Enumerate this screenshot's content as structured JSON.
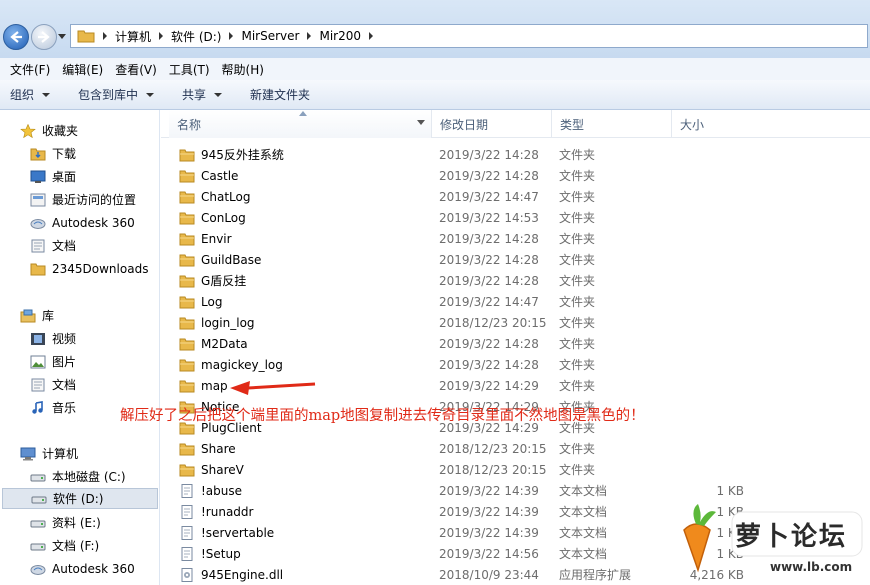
{
  "address": {
    "crumbs": [
      "计算机",
      "软件 (D:)",
      "MirServer",
      "Mir200"
    ]
  },
  "menu": [
    "文件(F)",
    "编辑(E)",
    "查看(V)",
    "工具(T)",
    "帮助(H)"
  ],
  "toolbar": {
    "organize": "组织",
    "include_library": "包含到库中",
    "share": "共享",
    "new_folder": "新建文件夹"
  },
  "sidebar": {
    "favorites": "收藏夹",
    "fav_items": [
      "下载",
      "桌面",
      "最近访问的位置",
      "Autodesk 360",
      "文档",
      "2345Downloads"
    ],
    "libraries": "库",
    "lib_items": [
      "视频",
      "图片",
      "文档",
      "音乐"
    ],
    "computer": "计算机",
    "comp_items": [
      "本地磁盘 (C:)",
      "软件 (D:)",
      "资料 (E:)",
      "文档 (F:)",
      "Autodesk 360"
    ]
  },
  "columns": {
    "name": "名称",
    "date": "修改日期",
    "type": "类型",
    "size": "大小"
  },
  "files": [
    {
      "name": "945反外挂系统",
      "date": "2019/3/22 14:28",
      "type": "文件夹",
      "size": "",
      "kind": "folder"
    },
    {
      "name": "Castle",
      "date": "2019/3/22 14:28",
      "type": "文件夹",
      "size": "",
      "kind": "folder"
    },
    {
      "name": "ChatLog",
      "date": "2019/3/22 14:47",
      "type": "文件夹",
      "size": "",
      "kind": "folder"
    },
    {
      "name": "ConLog",
      "date": "2019/3/22 14:53",
      "type": "文件夹",
      "size": "",
      "kind": "folder"
    },
    {
      "name": "Envir",
      "date": "2019/3/22 14:28",
      "type": "文件夹",
      "size": "",
      "kind": "folder"
    },
    {
      "name": "GuildBase",
      "date": "2019/3/22 14:28",
      "type": "文件夹",
      "size": "",
      "kind": "folder"
    },
    {
      "name": "G盾反挂",
      "date": "2019/3/22 14:28",
      "type": "文件夹",
      "size": "",
      "kind": "folder"
    },
    {
      "name": "Log",
      "date": "2019/3/22 14:47",
      "type": "文件夹",
      "size": "",
      "kind": "folder"
    },
    {
      "name": "login_log",
      "date": "2018/12/23 20:15",
      "type": "文件夹",
      "size": "",
      "kind": "folder"
    },
    {
      "name": "M2Data",
      "date": "2019/3/22 14:28",
      "type": "文件夹",
      "size": "",
      "kind": "folder"
    },
    {
      "name": "magickey_log",
      "date": "2019/3/22 14:28",
      "type": "文件夹",
      "size": "",
      "kind": "folder"
    },
    {
      "name": "map",
      "date": "2019/3/22 14:29",
      "type": "文件夹",
      "size": "",
      "kind": "folder"
    },
    {
      "name": "Notice",
      "date": "2019/3/22 14:29",
      "type": "文件夹",
      "size": "",
      "kind": "folder"
    },
    {
      "name": "PlugClient",
      "date": "2019/3/22 14:29",
      "type": "文件夹",
      "size": "",
      "kind": "folder"
    },
    {
      "name": "Share",
      "date": "2018/12/23 20:15",
      "type": "文件夹",
      "size": "",
      "kind": "folder"
    },
    {
      "name": "ShareV",
      "date": "2018/12/23 20:15",
      "type": "文件夹",
      "size": "",
      "kind": "folder"
    },
    {
      "name": "!abuse",
      "date": "2019/3/22 14:39",
      "type": "文本文档",
      "size": "1 KB",
      "kind": "text"
    },
    {
      "name": "!runaddr",
      "date": "2019/3/22 14:39",
      "type": "文本文档",
      "size": "1 KB",
      "kind": "text"
    },
    {
      "name": "!servertable",
      "date": "2019/3/22 14:39",
      "type": "文本文档",
      "size": "1 KB",
      "kind": "text"
    },
    {
      "name": "!Setup",
      "date": "2019/3/22 14:56",
      "type": "文本文档",
      "size": "1 KB",
      "kind": "text"
    },
    {
      "name": "945Engine.dll",
      "date": "2018/10/9 23:44",
      "type": "应用程序扩展",
      "size": "4,216 KB",
      "kind": "dll"
    }
  ],
  "annotation": "解压好了之后把这个端里面的map地图复制进去传奇目录里面不然地图是黑色的！",
  "watermark": {
    "brand": "萝卜论坛",
    "url": "www.lb.com"
  },
  "colors": {
    "annotation": "#e02a17",
    "folder": "#e8b84a",
    "selected": "#dfe6ef"
  }
}
